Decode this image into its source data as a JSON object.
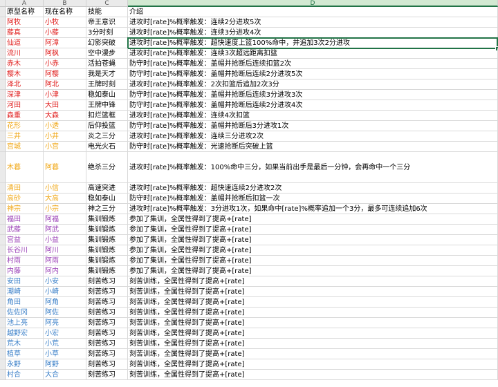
{
  "columns": [
    {
      "letter": "A",
      "width": 55
    },
    {
      "letter": "B",
      "width": 62
    },
    {
      "letter": "C",
      "width": 60
    },
    {
      "letter": "D",
      "width": 535
    }
  ],
  "active_column": "D",
  "header_row": {
    "cells": [
      "原型名称",
      "现在名称",
      "技能",
      "介绍"
    ],
    "colors": [
      "#000000",
      "#000000",
      "#000000",
      "#000000"
    ]
  },
  "rows": [
    {
      "cells": [
        "阿牧",
        "小牧",
        "帝王意识",
        "进攻时[rate]%概率触发：连续2分进攻5次"
      ],
      "colors": [
        "#e0201f",
        "#e0201f",
        "#000000",
        "#000000"
      ],
      "h": 1
    },
    {
      "cells": [
        "藤真",
        "小藤",
        "3分时刻",
        "进攻时[rate]%概率触发：连续3分进攻4次"
      ],
      "colors": [
        "#e0201f",
        "#e0201f",
        "#000000",
        "#000000"
      ],
      "h": 1
    },
    {
      "cells": [
        "仙道",
        "阿漳",
        "幻影突破",
        "进攻时[rate]%概率触发：超快速度上篮100%命中，并追加3次2分进攻"
      ],
      "colors": [
        "#e0201f",
        "#e0201f",
        "#000000",
        "#000000"
      ],
      "h": 1,
      "selected": true
    },
    {
      "cells": [
        "流川",
        "阿枫",
        "空中漫步",
        "进攻时[rate]%概率触发：连续3次超远距离扣篮"
      ],
      "colors": [
        "#e0201f",
        "#e0201f",
        "#000000",
        "#000000"
      ],
      "h": 1
    },
    {
      "cells": [
        "赤木",
        "小赤",
        "活拍苍蝇",
        "防守时[rate]%概率触发：盖帽并抢断后连续扣篮2次"
      ],
      "colors": [
        "#e0201f",
        "#e0201f",
        "#000000",
        "#000000"
      ],
      "h": 1
    },
    {
      "cells": [
        "樱木",
        "阿樱",
        "我是天才",
        "防守时[rate]%概率触发：盖帽并抢断后连续2分进攻5次"
      ],
      "colors": [
        "#e0201f",
        "#e0201f",
        "#000000",
        "#000000"
      ],
      "h": 1
    },
    {
      "cells": [
        "泽北",
        "阿北",
        "王牌时刻",
        "进攻时[rate]%概率触发：2次扣篮后追加2次3分"
      ],
      "colors": [
        "#e0201f",
        "#e0201f",
        "#000000",
        "#000000"
      ],
      "h": 1
    },
    {
      "cells": [
        "深津",
        "小津",
        "稳如泰山",
        "防守时[rate]%概率触发：盖帽并抢断后连续3分进攻3次"
      ],
      "colors": [
        "#e0201f",
        "#e0201f",
        "#000000",
        "#000000"
      ],
      "h": 1
    },
    {
      "cells": [
        "河田",
        "大田",
        "王牌中锋",
        "防守时[rate]%概率触发：盖帽并抢断后连续2分进攻4次"
      ],
      "colors": [
        "#e0201f",
        "#e0201f",
        "#000000",
        "#000000"
      ],
      "h": 1
    },
    {
      "cells": [
        "森重",
        "大森",
        "扣烂篮框",
        "进攻时[rate]%概率触发：连续4次扣篮"
      ],
      "colors": [
        "#e0201f",
        "#e0201f",
        "#000000",
        "#000000"
      ],
      "h": 1
    },
    {
      "cells": [
        "花形",
        "小透",
        "后仰投篮",
        "防守时[rate]%概率触发：盖帽并抢断后3分进攻1次"
      ],
      "colors": [
        "#f0a818",
        "#f0a818",
        "#000000",
        "#000000"
      ],
      "h": 1
    },
    {
      "cells": [
        "三井",
        "小井",
        "炎之三分",
        "进攻时[rate]%概率触发：连续三分进攻2次"
      ],
      "colors": [
        "#f0a818",
        "#f0a818",
        "#000000",
        "#000000"
      ],
      "h": 1
    },
    {
      "cells": [
        "宫城",
        "小宫",
        "电光火石",
        "防守时[rate]%概率触发：光速抢断后突破上篮"
      ],
      "colors": [
        "#f0a818",
        "#f0a818",
        "#000000",
        "#000000"
      ],
      "h": 1
    },
    {
      "cells": [
        "木暮",
        "阿暮",
        "绝杀三分",
        "进攻时[rate]%概率触发：100%命中三分，如果当前出手是最后一分钟，会再命中一个三分"
      ],
      "colors": [
        "#f0a818",
        "#f0a818",
        "#000000",
        "#000000"
      ],
      "h": 3
    },
    {
      "cells": [
        "清田",
        "小信",
        "高速突进",
        "进攻时[rate]%概率触发：超快速连续2分进攻2次"
      ],
      "colors": [
        "#f0a818",
        "#f0a818",
        "#000000",
        "#000000"
      ],
      "h": 1
    },
    {
      "cells": [
        "高砂",
        "大高",
        "稳如泰山",
        "防守时[rate]%概率触发：盖帽并抢断后扣篮一次"
      ],
      "colors": [
        "#f0a818",
        "#f0a818",
        "#000000",
        "#000000"
      ],
      "h": 1
    },
    {
      "cells": [
        "神宗",
        "小宗",
        "神之三分",
        "进攻时[rate]%概率触发：3分进攻1次，如果命中[rate]%概率追加一个3分，最多可连续追加6次"
      ],
      "colors": [
        "#f0a818",
        "#f0a818",
        "#000000",
        "#000000"
      ],
      "h": 1
    },
    {
      "cells": [
        "福田",
        "阿福",
        "集训锻炼",
        "参加了集训，全属性得到了提高+[rate]"
      ],
      "colors": [
        "#9a3fb6",
        "#9a3fb6",
        "#000000",
        "#000000"
      ],
      "h": 1
    },
    {
      "cells": [
        "武藤",
        "阿武",
        "集训锻炼",
        "参加了集训，全属性得到了提高+[rate]"
      ],
      "colors": [
        "#9a3fb6",
        "#9a3fb6",
        "#000000",
        "#000000"
      ],
      "h": 1
    },
    {
      "cells": [
        "宫益",
        "小益",
        "集训锻炼",
        "参加了集训，全属性得到了提高+[rate]"
      ],
      "colors": [
        "#9a3fb6",
        "#9a3fb6",
        "#000000",
        "#000000"
      ],
      "h": 1
    },
    {
      "cells": [
        "长谷川",
        "阿川",
        "集训锻炼",
        "参加了集训，全属性得到了提高+[rate]"
      ],
      "colors": [
        "#9a3fb6",
        "#9a3fb6",
        "#000000",
        "#000000"
      ],
      "h": 1
    },
    {
      "cells": [
        "村雨",
        "阿雨",
        "集训锻炼",
        "参加了集训，全属性得到了提高+[rate]"
      ],
      "colors": [
        "#9a3fb6",
        "#9a3fb6",
        "#000000",
        "#000000"
      ],
      "h": 1
    },
    {
      "cells": [
        "内藤",
        "阿内",
        "集训锻炼",
        "参加了集训，全属性得到了提高+[rate]"
      ],
      "colors": [
        "#9a3fb6",
        "#9a3fb6",
        "#000000",
        "#000000"
      ],
      "h": 1
    },
    {
      "cells": [
        "安田",
        "小安",
        "刻苦练习",
        "刻苦训练，全属性得到了提高+[rate]"
      ],
      "colors": [
        "#3a7fc8",
        "#3a7fc8",
        "#000000",
        "#000000"
      ],
      "h": 1
    },
    {
      "cells": [
        "潮崎",
        "小崎",
        "刻苦练习",
        "刻苦训练，全属性得到了提高+[rate]"
      ],
      "colors": [
        "#3a7fc8",
        "#3a7fc8",
        "#000000",
        "#000000"
      ],
      "h": 1
    },
    {
      "cells": [
        "角田",
        "阿角",
        "刻苦练习",
        "刻苦训练，全属性得到了提高+[rate]"
      ],
      "colors": [
        "#3a7fc8",
        "#3a7fc8",
        "#000000",
        "#000000"
      ],
      "h": 1
    },
    {
      "cells": [
        "佐佐冈",
        "阿佐",
        "刻苦练习",
        "刻苦训练，全属性得到了提高+[rate]"
      ],
      "colors": [
        "#3a7fc8",
        "#3a7fc8",
        "#000000",
        "#000000"
      ],
      "h": 1
    },
    {
      "cells": [
        "池上亮",
        "阿亮",
        "刻苦练习",
        "刻苦训练，全属性得到了提高+[rate]"
      ],
      "colors": [
        "#3a7fc8",
        "#3a7fc8",
        "#000000",
        "#000000"
      ],
      "h": 1
    },
    {
      "cells": [
        "越野宏",
        "小宏",
        "刻苦练习",
        "刻苦训练，全属性得到了提高+[rate]"
      ],
      "colors": [
        "#3a7fc8",
        "#3a7fc8",
        "#000000",
        "#000000"
      ],
      "h": 1
    },
    {
      "cells": [
        "荒木",
        "小荒",
        "刻苦练习",
        "刻苦训练，全属性得到了提高+[rate]"
      ],
      "colors": [
        "#3a7fc8",
        "#3a7fc8",
        "#000000",
        "#000000"
      ],
      "h": 1
    },
    {
      "cells": [
        "植草",
        "小草",
        "刻苦练习",
        "刻苦训练，全属性得到了提高+[rate]"
      ],
      "colors": [
        "#3a7fc8",
        "#3a7fc8",
        "#000000",
        "#000000"
      ],
      "h": 1
    },
    {
      "cells": [
        "永野",
        "阿野",
        "刻苦练习",
        "刻苦训练，全属性得到了提高+[rate]"
      ],
      "colors": [
        "#3a7fc8",
        "#3a7fc8",
        "#000000",
        "#000000"
      ],
      "h": 1
    },
    {
      "cells": [
        "村合",
        "大合",
        "刻苦练习",
        "刻苦训练，全属性得到了提高+[rate]"
      ],
      "colors": [
        "#3a7fc8",
        "#3a7fc8",
        "#000000",
        "#000000"
      ],
      "h": 1
    }
  ]
}
